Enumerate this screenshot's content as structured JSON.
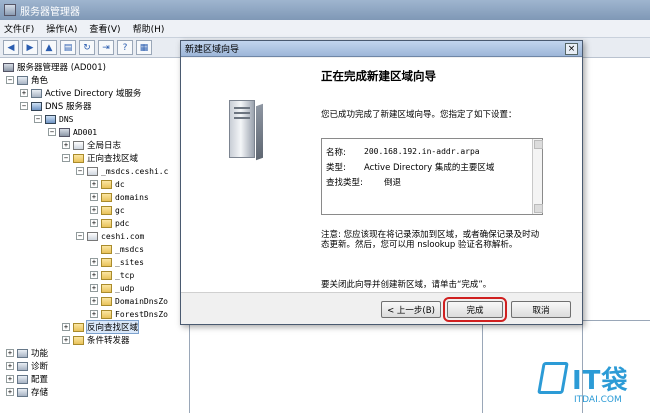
{
  "window": {
    "title": "服务器管理器"
  },
  "menu": [
    "文件(F)",
    "操作(A)",
    "查看(V)",
    "帮助(H)"
  ],
  "tree": {
    "root": "服务器管理器 (AD001)",
    "roles": "角色",
    "ad": "Active Directory 域服务",
    "dns_server": "DNS 服务器",
    "dns": "DNS",
    "host": "AD001",
    "global_log": "全局日志",
    "forward_zones": "正向查找区域",
    "msdcs": "_msdcs.ceshi.c",
    "dc": "dc",
    "domains": "domains",
    "gc": "gc",
    "pdc": "pdc",
    "ceshi": "ceshi.com",
    "msdcs2": "_msdcs",
    "sites": "_sites",
    "tcp": "_tcp",
    "udp": "_udp",
    "domaindns": "DomainDnsZo",
    "forestdns": "ForestDnsZo",
    "reverse_zones": "反向查找区域",
    "conditional": "条件转发器",
    "features": "功能",
    "diagnostics": "诊断",
    "config": "配置",
    "storage": "存储"
  },
  "dialog": {
    "title": "新建区域向导",
    "close": "×",
    "heading": "正在完成新建区域向导",
    "description": "您已成功完成了新建区域向导。您指定了如下设置：",
    "summary": [
      {
        "key": "名称:",
        "value": "200.168.192.in-addr.arpa"
      },
      {
        "key": "类型:",
        "value": "Active Directory 集成的主要区域"
      },
      {
        "key": "查找类型:",
        "value": "倒退"
      }
    ],
    "note": "注意: 您应该现在将记录添加到区域，或者确保记录及时动态更新。然后，您可以用 nslookup 验证名称解析。",
    "finish_hint": "要关闭此向导并创建新区域，请单击“完成”。",
    "buttons": {
      "back": "< 上一步(B)",
      "finish": "完成",
      "cancel": "取消"
    }
  },
  "watermark": {
    "brand": "IT袋",
    "url": "ITDAI.COM"
  }
}
